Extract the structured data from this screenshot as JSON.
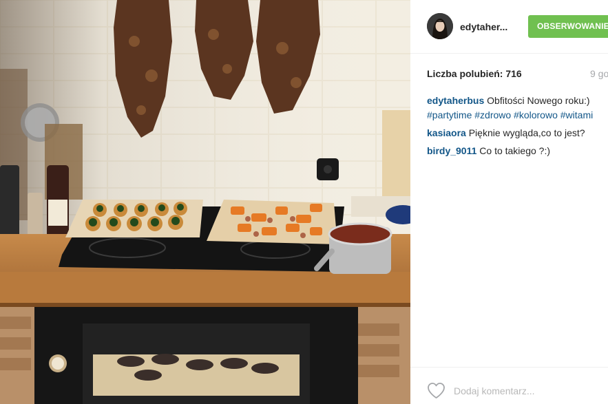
{
  "post": {
    "photo_alt": "",
    "author": {
      "username": "edytaher...",
      "avatar_icon": "avatar-photo-icon"
    },
    "follow_label": "OBSERWOWANIE",
    "likes_label": "Liczba polubień: 716",
    "time_ago": "9 go",
    "comments": [
      {
        "user": "edytaherbus",
        "text": " Obfitości Nowego roku:)",
        "hashtags": "#partytime #zdrowo #kolorowo #witami"
      },
      {
        "user": "kasiaora",
        "text": " Pięknie wygląda,co to jest?"
      },
      {
        "user": "birdy_9011",
        "text": " Co to takiego ?:)"
      }
    ],
    "comment_placeholder": "Dodaj komentarz...",
    "like_icon": "heart-icon"
  },
  "colors": {
    "follow_button": "#70c050",
    "username_link": "#125688",
    "muted_text": "#a5a7aa",
    "placeholder": "#b8b8b8"
  }
}
